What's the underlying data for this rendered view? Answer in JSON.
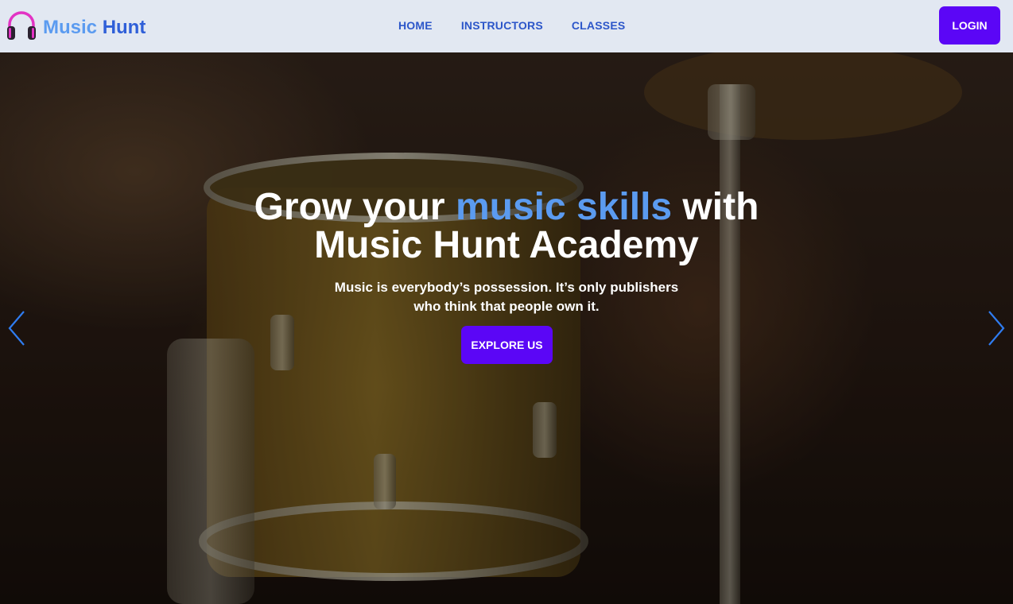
{
  "brand": {
    "name_part1": "Music",
    "name_part2": "Hunt",
    "logo_icon": "headphones-icon"
  },
  "nav": {
    "items": [
      {
        "label": "HOME"
      },
      {
        "label": "INSTRUCTORS"
      },
      {
        "label": "CLASSES"
      }
    ],
    "login_label": "LOGIN"
  },
  "hero": {
    "headline_pre": "Grow your ",
    "headline_accent": "music skills",
    "headline_post": " with",
    "headline_line2": "Music Hunt Academy",
    "subtext_line1": "Music is everybody’s possession. It’s only publishers",
    "subtext_line2": "who think that people own it.",
    "cta_label": "EXPLORE US",
    "prev_icon": "chevron-left-icon",
    "next_icon": "chevron-right-icon"
  },
  "colors": {
    "accent": "#5b9bf0",
    "primary_button": "#5b06f6",
    "nav_bg": "#e2e8f2",
    "nav_link": "#2c56c9"
  }
}
